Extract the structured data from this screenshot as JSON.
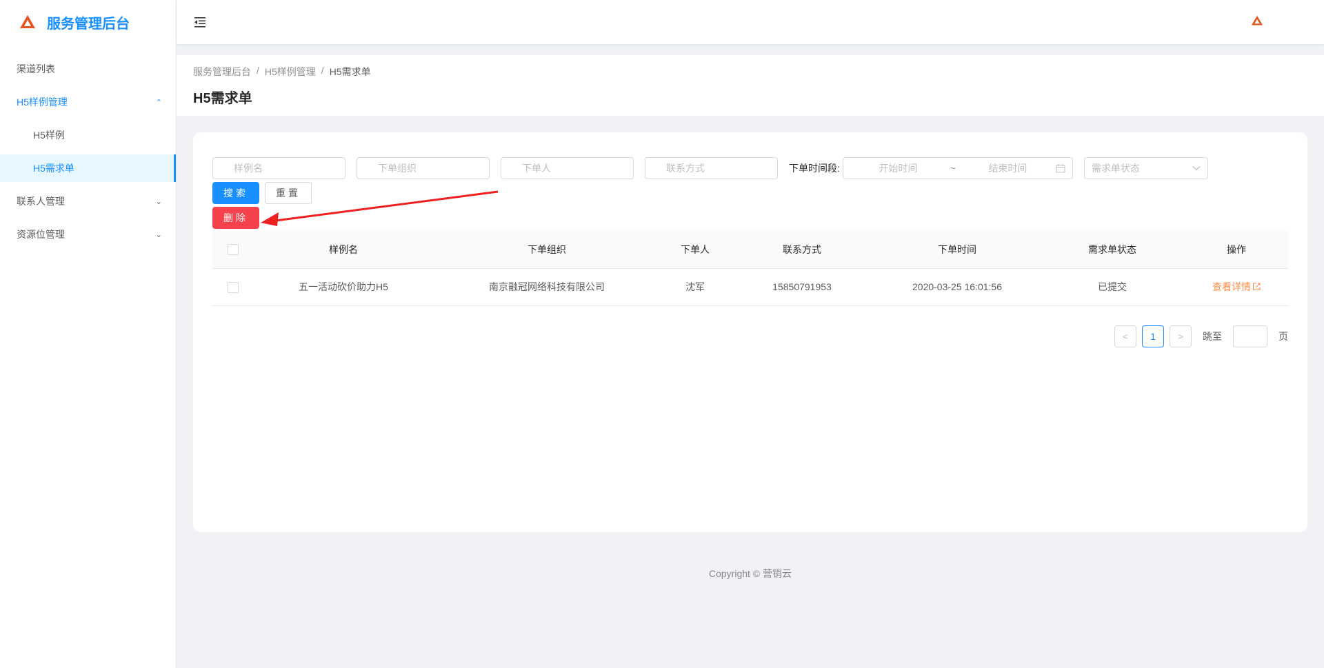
{
  "app": {
    "title": "服务管理后台",
    "brand_color": "#1890ff",
    "logo_color": "#e8531f"
  },
  "sidebar": {
    "items": [
      {
        "label": "渠道列表"
      },
      {
        "label": "H5样例管理"
      },
      {
        "label": "H5样例"
      },
      {
        "label": "H5需求单"
      },
      {
        "label": "联系人管理"
      },
      {
        "label": "资源位管理"
      }
    ]
  },
  "breadcrumb": [
    "服务管理后台",
    "/",
    "H5样例管理",
    "/",
    "H5需求单"
  ],
  "page": {
    "title": "H5需求单"
  },
  "filters": {
    "sample_name_placeholder": "样例名",
    "org_placeholder": "下单组织",
    "orderer_placeholder": "下单人",
    "contact_placeholder": "联系方式",
    "range_label": "下单时间段:",
    "start_placeholder": "开始时间",
    "range_sep": "~",
    "end_placeholder": "结束时间",
    "status_placeholder": "需求单状态"
  },
  "buttons": {
    "search": "搜索",
    "reset": "重置",
    "delete": "删除"
  },
  "table": {
    "headers": [
      "样例名",
      "下单组织",
      "下单人",
      "联系方式",
      "下单时间",
      "需求单状态",
      "操作"
    ],
    "rows": [
      {
        "sample": "五一活动砍价助力H5",
        "org": "南京融冠网络科技有限公司",
        "orderer": "沈军",
        "contact": "15850791953",
        "time": "2020-03-25 16:01:56",
        "status": "已提交",
        "action": "查看详情"
      }
    ]
  },
  "pagination": {
    "prev": "<",
    "page": "1",
    "next": ">",
    "jump_label": "跳至",
    "page_suffix": "页"
  },
  "footer": {
    "text": "Copyright © 营销云"
  }
}
